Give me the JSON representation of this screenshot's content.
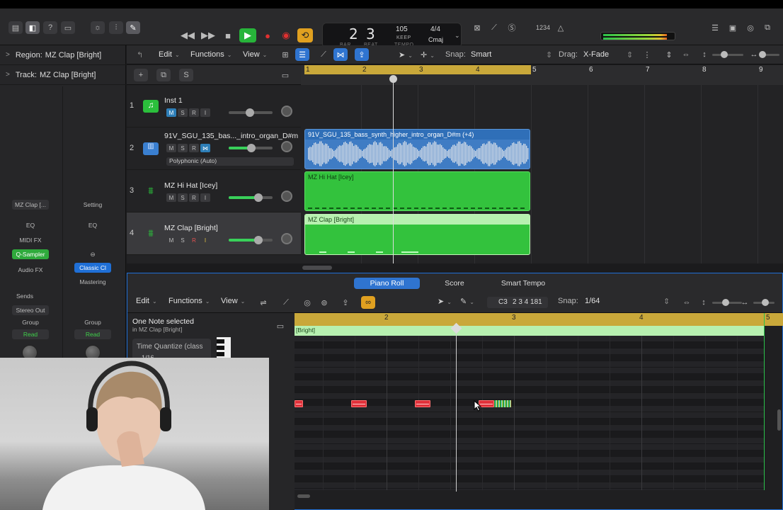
{
  "toolbar": {
    "lcd": {
      "bar": "2",
      "beat": "3",
      "bar_label": "BAR",
      "beat_label": "BEAT",
      "tempo": "105",
      "tempo_mode": "KEEP",
      "tempo_label": "TEMPO",
      "time_signature": "4/4",
      "key": "Cmaj"
    },
    "count_in": "1234",
    "meter_level": 0.9
  },
  "inspector": {
    "region_label": "Region:",
    "region_name": "MZ Clap [Bright]",
    "track_label": "Track:",
    "track_name": "MZ Clap [Bright]",
    "strip1": {
      "name": "MZ Clap [...",
      "eq": "EQ",
      "midi_fx": "MIDI FX",
      "instrument": "Q-Sampler",
      "audio_fx": "Audio FX",
      "sends": "Sends",
      "output": "Stereo Out",
      "group": "Group",
      "automation": "Read"
    },
    "strip2": {
      "setting": "Setting",
      "eq": "EQ",
      "plugin": "Classic Cl",
      "mastering": "Mastering",
      "group": "Group",
      "automation": "Read"
    }
  },
  "tracks_toolbar": {
    "edit": "Edit",
    "functions": "Functions",
    "view": "View",
    "snap_label": "Snap:",
    "snap_value": "Smart",
    "drag_label": "Drag:",
    "drag_value": "X-Fade"
  },
  "track_header_bar": {
    "add": "+",
    "duplicate": "⧉",
    "solo": "S"
  },
  "ruler": {
    "bars": [
      "1",
      "2",
      "3",
      "4",
      "5",
      "6",
      "7",
      "8",
      "9"
    ]
  },
  "tracks": [
    {
      "number": "1",
      "name": "Inst 1",
      "buttons": [
        "M",
        "S",
        "R",
        "I"
      ]
    },
    {
      "number": "2",
      "name": "91V_SGU_135_bas..._intro_organ_D#m",
      "buttons": [
        "M",
        "S",
        "R"
      ],
      "mode": "Polyphonic (Auto)"
    },
    {
      "number": "3",
      "name": "MZ Hi Hat [Icey]",
      "buttons": [
        "M",
        "S",
        "R",
        "I"
      ]
    },
    {
      "number": "4",
      "name": "MZ Clap [Bright]",
      "buttons": [
        "M",
        "S",
        "R",
        "I"
      ]
    }
  ],
  "regions": {
    "audio": "91V_SGU_135_bass_synth_higher_intro_organ_D#m (+4)",
    "hihat": "MZ Hi Hat [Icey]",
    "clap": "MZ Clap [Bright]"
  },
  "editor": {
    "tabs": [
      "Piano Roll",
      "Score",
      "Smart Tempo"
    ],
    "edit": "Edit",
    "functions": "Functions",
    "view": "View",
    "pitch": "C3",
    "position": "2 3 4 181",
    "snap_label": "Snap:",
    "snap_value": "1/64",
    "selection_title": "One Note selected",
    "selection_sub": "in MZ Clap [Bright]",
    "time_quantize": "Time Quantize (class",
    "quantize_value": "1/16",
    "ruler_bars": [
      "2",
      "3",
      "4",
      "5"
    ],
    "region_label": "[Bright]"
  },
  "colors": {
    "region_green": "#33c23d",
    "region_blue": "#2f6fb8",
    "cycle_yellow": "#c9a83a",
    "note_red": "#e0303a",
    "tab_blue": "#2f74d0"
  }
}
